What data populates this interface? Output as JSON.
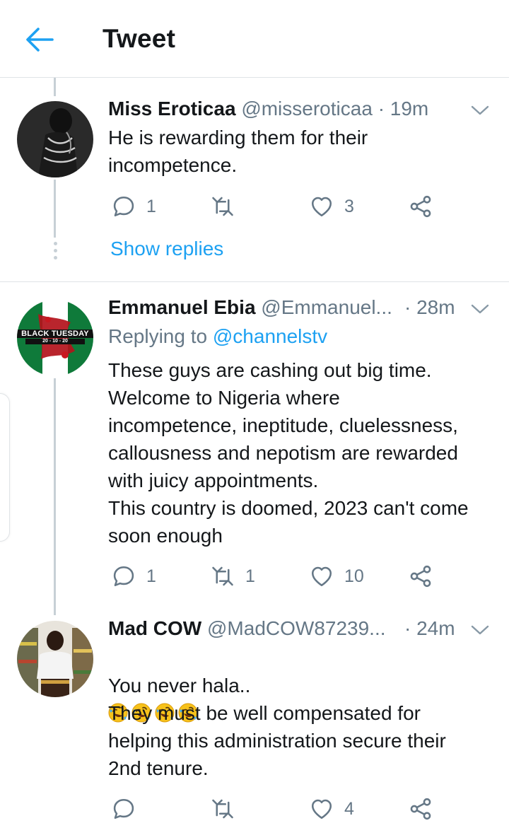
{
  "header": {
    "title": "Tweet"
  },
  "colors": {
    "accent": "#1da1f2",
    "muted": "#657786",
    "text": "#14171a",
    "divider": "#dfe3e6"
  },
  "tweets": [
    {
      "name": "Miss Eroticaa",
      "handle": "@misseroticaa",
      "time": "· 19m",
      "text": "He is rewarding them for their\nincompetence.",
      "replies": "1",
      "retweets": "",
      "likes": "3",
      "show_replies": "Show replies"
    },
    {
      "name": "Emmanuel Ebia",
      "handle": "@Emmanuel...",
      "time": "· 28m",
      "replying_prefix": "Replying to",
      "replying_handle": "@channelstv",
      "avatar_text": "BLACK TUESDAY",
      "avatar_date": "20 - 10 - 20",
      "text": "These guys are cashing out big time.\nWelcome to Nigeria where\nincompetence, ineptitude, cluelessness,\ncallousness and nepotism are rewarded\nwith juicy appointments.\nThis country is doomed, 2023 can't come\nsoon enough",
      "replies": "1",
      "retweets": "1",
      "likes": "10"
    },
    {
      "name": "Mad COW",
      "handle": "@MadCOW87239...",
      "time": "· 24m",
      "text_first": "You never hala..",
      "emoji": "rofl-emoji",
      "text_rest": "They must be well compensated for\nhelping this administration secure their\n2nd tenure.",
      "replies": "",
      "retweets": "",
      "likes": "4"
    }
  ],
  "icons": {
    "back": "arrow-left-icon",
    "reply": "reply-icon",
    "retweet": "retweet-icon",
    "like": "heart-icon",
    "share": "share-icon",
    "caret": "chevron-down-icon"
  }
}
